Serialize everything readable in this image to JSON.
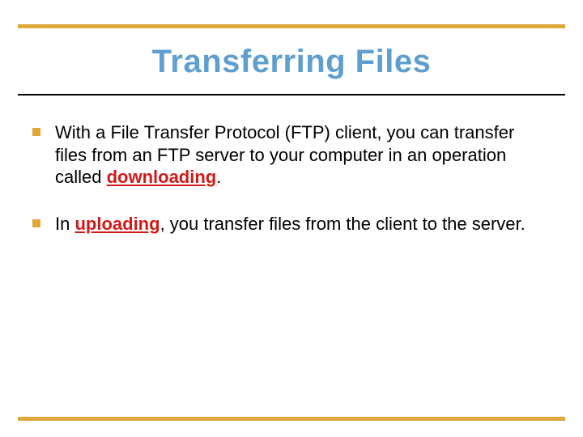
{
  "title": "Transferring Files",
  "colors": {
    "accent_bar": "#e0a83a",
    "title_text": "#5f9fd0",
    "keyword": "#d11a1a",
    "rule_mid": "#000000"
  },
  "bullets": [
    {
      "before": "With a File Transfer Protocol (FTP) client, you can transfer files from an FTP server to your computer in an operation called ",
      "keyword": "downloading",
      "after": "."
    },
    {
      "before": "In ",
      "keyword": "uploading",
      "after": ", you transfer files from the client to the server."
    }
  ]
}
